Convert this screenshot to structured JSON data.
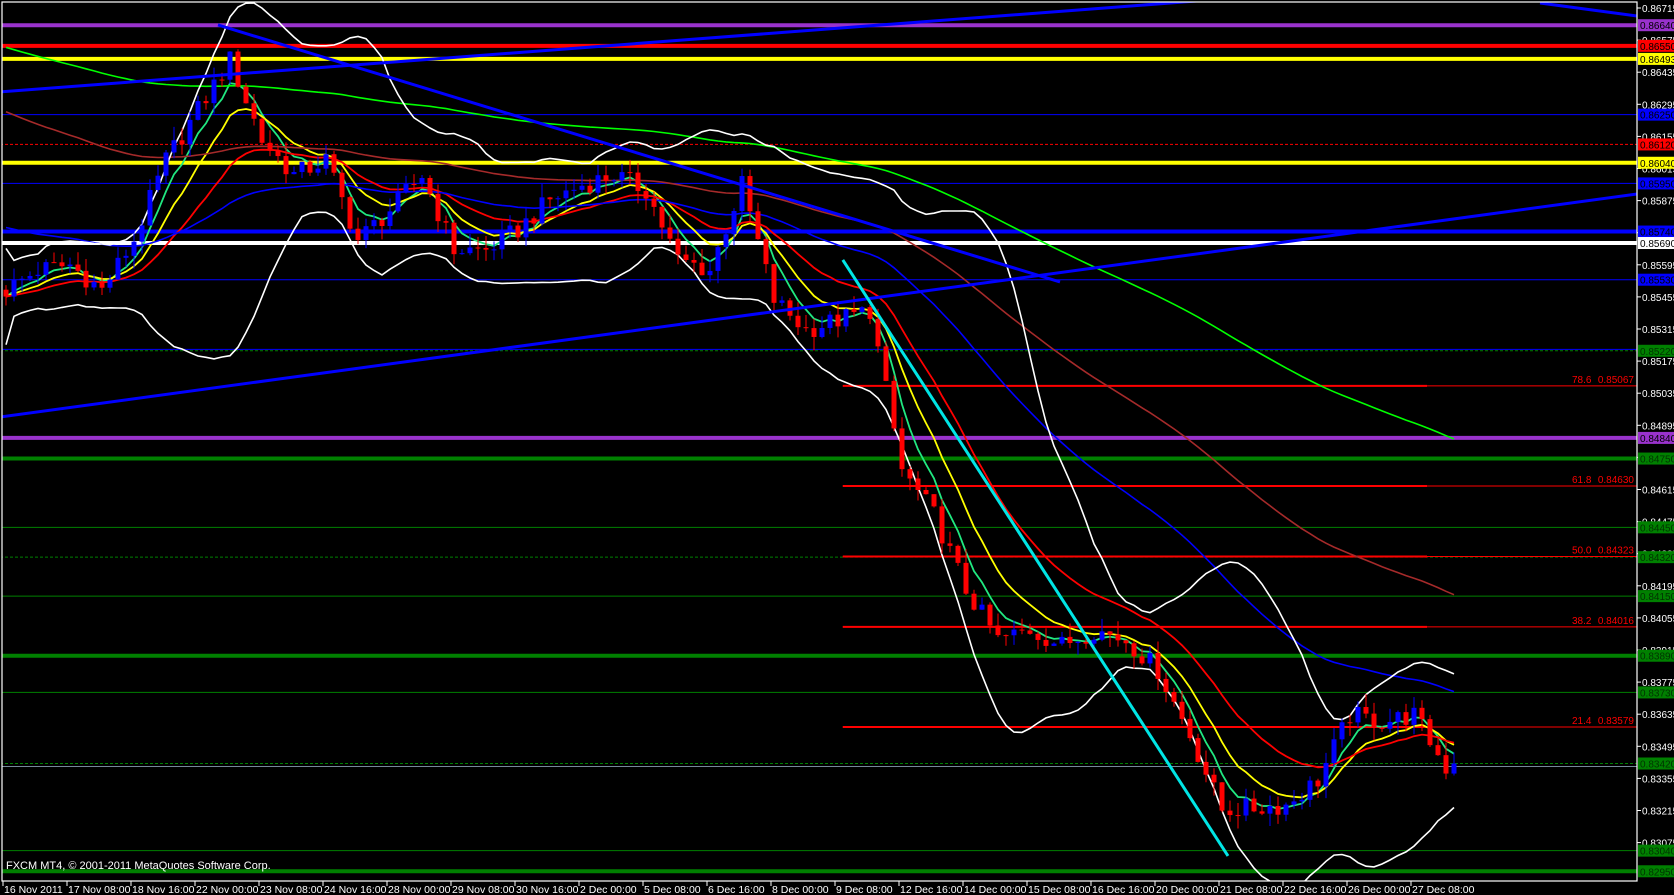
{
  "footer": {
    "copyright": "FXCM MT4, © 2001-2011 MetaQuotes Software Corp."
  },
  "colors": {
    "background": "#000000",
    "frame": "#ffffff",
    "bull": "#0000ff",
    "bear": "#ff0000",
    "fib": "#ff0000",
    "trendline": "#0000ff",
    "cyan_line": "#00e5e5",
    "grid_text": "#ffffff"
  },
  "chart_data": {
    "type": "candlestick",
    "timeframe_candles_per_label": 8,
    "candle_count": 182,
    "x_labels": [
      "16 Nov 2011",
      "17 Nov 08:00",
      "18 Nov 16:00",
      "22 Nov 00:00",
      "23 Nov 08:00",
      "24 Nov 16:00",
      "28 Nov 00:00",
      "29 Nov 08:00",
      "30 Nov 16:00",
      "2 Dec 00:00",
      "5 Dec 08:00",
      "6 Dec 16:00",
      "8 Dec 00:00",
      "9 Dec 08:00",
      "12 Dec 16:00",
      "14 Dec 00:00",
      "15 Dec 08:00",
      "16 Dec 16:00",
      "20 Dec 00:00",
      "21 Dec 08:00",
      "22 Dec 16:00",
      "26 Dec 00:00",
      "27 Dec 08:00"
    ],
    "y_ticks": [
      "0.86715",
      "0.86575",
      "0.86435",
      "0.86295",
      "0.86155",
      "0.86015",
      "0.85875",
      "0.85735",
      "0.85595",
      "0.85455",
      "0.85315",
      "0.85175",
      "0.85035",
      "0.84895",
      "0.84755",
      "0.84615",
      "0.84475",
      "0.84335",
      "0.84195",
      "0.84055",
      "0.83915",
      "0.83775",
      "0.83635",
      "0.83495",
      "0.83355",
      "0.83215",
      "0.83075"
    ],
    "ylim": [
      0.829,
      0.8675
    ],
    "close_keypoints": {
      "every_n_candles": 4,
      "values": [
        0.85485,
        0.85572,
        0.85594,
        0.85485,
        0.85703,
        0.86052,
        0.8627,
        0.86488,
        0.86139,
        0.85987,
        0.86052,
        0.85703,
        0.85834,
        0.85987,
        0.8566,
        0.8566,
        0.85747,
        0.85878,
        0.85943,
        0.85987,
        0.85921,
        0.85616,
        0.85572,
        0.85943,
        0.85442,
        0.85311,
        0.85354,
        0.85398,
        0.847,
        0.84504,
        0.84177,
        0.83959,
        0.84003,
        0.83937,
        0.84003,
        0.83959,
        0.83828,
        0.83545,
        0.83218,
        0.83226,
        0.83239,
        0.83348,
        0.83632,
        0.83601,
        0.83632,
        0.83401
      ]
    },
    "last_price": 0.8342,
    "levels": [
      {
        "price": 0.8664,
        "label": "0.86640",
        "color": "#9932cc",
        "style": "thick"
      },
      {
        "price": 0.8655,
        "label": "0.86550",
        "color": "#ff0000",
        "style": "thick"
      },
      {
        "price": 0.86493,
        "label": "0.86493",
        "color": "#ffff00",
        "style": "thick"
      },
      {
        "price": 0.8625,
        "label": "0.86250",
        "color": "#0000ff",
        "style": "thin"
      },
      {
        "price": 0.8612,
        "label": "0.86120",
        "color": "#ff0000",
        "style": "dashed"
      },
      {
        "price": 0.8604,
        "label": "0.86040",
        "color": "#ffff00",
        "style": "thick"
      },
      {
        "price": 0.8595,
        "label": "0.85950",
        "color": "#0000ff",
        "style": "thin"
      },
      {
        "price": 0.8574,
        "label": "0.85740",
        "color": "#0000ff",
        "style": "thick"
      },
      {
        "price": 0.8569,
        "label": "0.85690",
        "color": "#ffffff",
        "style": "thick"
      },
      {
        "price": 0.8553,
        "label": "0.85530",
        "color": "#0000ff",
        "style": "thin"
      },
      {
        "price": 0.85226,
        "label": "",
        "color": "#0000ff",
        "style": "thin"
      },
      {
        "price": 0.8522,
        "label": "0.85220",
        "color": "#008000",
        "style": "dashed"
      },
      {
        "price": 0.8484,
        "label": "0.84840",
        "color": "#9932cc",
        "style": "thick"
      },
      {
        "price": 0.8475,
        "label": "0.84750",
        "color": "#008000",
        "style": "thick"
      },
      {
        "price": 0.8445,
        "label": "0.84450",
        "color": "#008000",
        "style": "thin"
      },
      {
        "price": 0.8432,
        "label": "0.84320",
        "color": "#008000",
        "style": "dashed"
      },
      {
        "price": 0.8415,
        "label": "0.84150",
        "color": "#008000",
        "style": "thin"
      },
      {
        "price": 0.8389,
        "label": "0.83890",
        "color": "#008000",
        "style": "thick"
      },
      {
        "price": 0.8373,
        "label": "0.83730",
        "color": "#008000",
        "style": "thin"
      },
      {
        "price": 0.8342,
        "label": "0.83420",
        "color": "#008000",
        "style": "dashed"
      },
      {
        "price": 0.8304,
        "label": "0.83040",
        "color": "#008000",
        "style": "thin"
      },
      {
        "price": 0.8295,
        "label": "0.82950",
        "color": "#008000",
        "style": "thick"
      }
    ],
    "fibonacci": {
      "start_candle": 104.6,
      "levels": [
        {
          "ratio": "78.6",
          "price": "0.85067"
        },
        {
          "ratio": "61.8",
          "price": "0.84630"
        },
        {
          "ratio": "50.0",
          "price": "0.84323"
        },
        {
          "ratio": "38.2",
          "price": "0.84016"
        },
        {
          "ratio": "21.4",
          "price": "0.83579"
        }
      ]
    },
    "trendlines": [
      {
        "from": [
          -0.75,
          0.86349
        ],
        "to": [
          150.5,
          0.8675
        ],
        "color": "#0000ff"
      },
      {
        "from": [
          191.75,
          0.86737
        ],
        "to": [
          203.9,
          0.8668
        ],
        "color": "#0000ff"
      },
      {
        "from": [
          26.5,
          0.86641
        ],
        "to": [
          131.75,
          0.8552
        ],
        "color": "#0000ff"
      },
      {
        "from": [
          -0.75,
          0.84931
        ],
        "to": [
          203.9,
          0.85904
        ],
        "color": "#0000ff"
      },
      {
        "from": [
          104.6,
          0.85616
        ],
        "to": [
          152.75,
          0.83017
        ],
        "color": "#00e5e5"
      }
    ],
    "indicators": [
      {
        "name": "EMA",
        "period": 5,
        "color": "#20e880"
      },
      {
        "name": "EMA",
        "period": 10,
        "color": "#ffff00"
      },
      {
        "name": "EMA",
        "period": 21,
        "color": "#ff0000"
      },
      {
        "name": "EMA",
        "period": 55,
        "color": "#0000ff",
        "start": 0.85769
      },
      {
        "name": "EMA",
        "period": 100,
        "color": "#a52a2a",
        "start": 0.86279
      },
      {
        "name": "EMA",
        "period": 200,
        "color": "#00ff00",
        "start": 0.86554
      },
      {
        "name": "Bollinger",
        "period": 20,
        "deviation": 2,
        "color": "#ffffff"
      }
    ]
  }
}
